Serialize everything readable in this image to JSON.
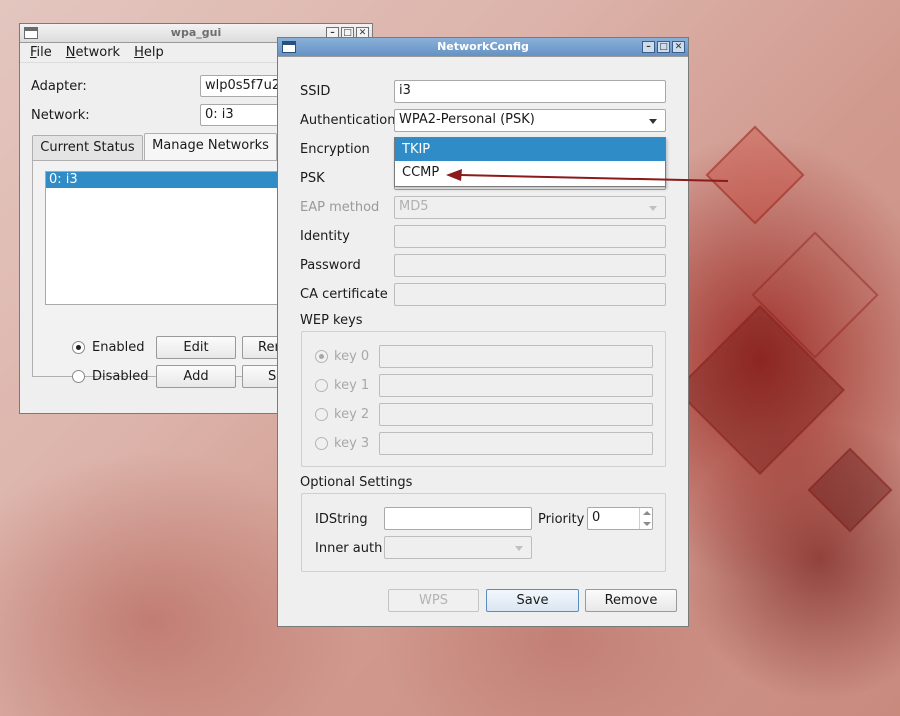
{
  "wpa_gui": {
    "title": "wpa_gui",
    "menu": [
      "File",
      "Network",
      "Help"
    ],
    "adapter_label": "Adapter:",
    "adapter_value": "wlp0s5f7u2",
    "network_label": "Network:",
    "network_value": "0: i3",
    "tabs": [
      "Current Status",
      "Manage Networks"
    ],
    "active_tab": "Manage Networks",
    "networks": [
      "0: i3"
    ],
    "enabled_label": "Enabled",
    "disabled_label": "Disabled",
    "enabled_selected": true,
    "edit_label": "Edit",
    "add_label": "Add",
    "remove_label_partial": "Ren",
    "scan_label_partial": "Sc"
  },
  "network_config": {
    "title": "NetworkConfig",
    "ssid_label": "SSID",
    "ssid_value": "i3",
    "auth_label": "Authentication",
    "auth_value": "WPA2-Personal (PSK)",
    "encryption_label": "Encryption",
    "encryption_options": [
      "TKIP",
      "CCMP"
    ],
    "encryption_highlighted": "TKIP",
    "psk_label": "PSK",
    "eap_label": "EAP method",
    "eap_value": "MD5",
    "identity_label": "Identity",
    "password_label": "Password",
    "ca_label": "CA certificate",
    "wep_group_label": "WEP keys",
    "wep_keys": [
      "key 0",
      "key 1",
      "key 2",
      "key 3"
    ],
    "optional_group_label": "Optional Settings",
    "idstring_label": "IDString",
    "priority_label": "Priority",
    "priority_value": "0",
    "inner_auth_label": "Inner auth",
    "wps_label": "WPS",
    "save_label": "Save",
    "remove_label": "Remove"
  },
  "colors": {
    "selection": "#308cc6",
    "active_titlebar": "#6592c4",
    "annotation_arrow": "#8b1a1a"
  }
}
